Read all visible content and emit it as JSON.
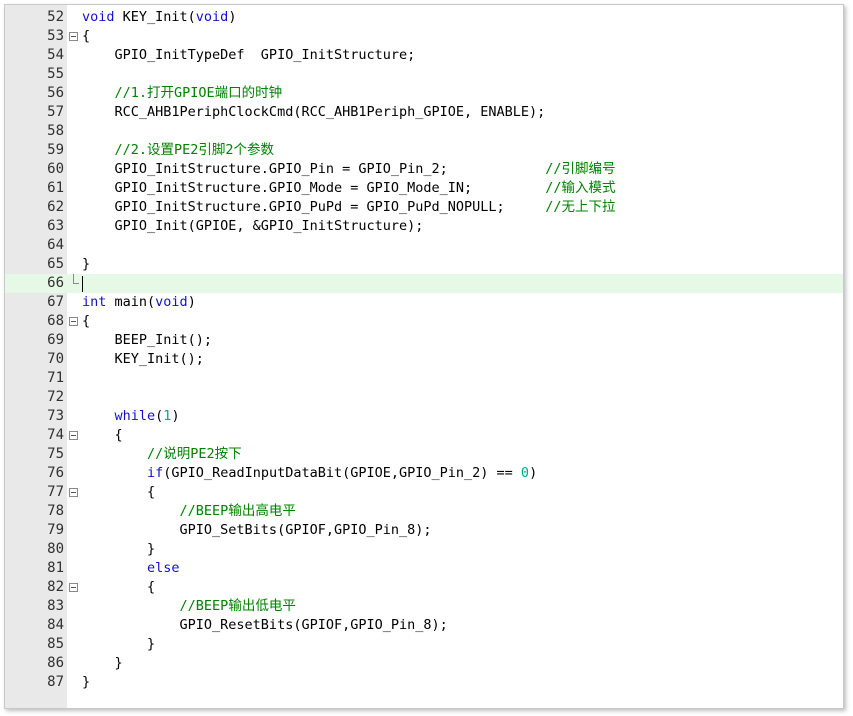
{
  "editor": {
    "colors": {
      "keyword": "#1111cc",
      "comment": "#008000",
      "number": "#00aa88",
      "text": "#000000",
      "gutter": "#e9e9e9",
      "current_line": "#e6f9e6"
    },
    "lines": [
      {
        "num": "52",
        "fold": "",
        "segments": [
          {
            "t": "kw",
            "v": "void"
          },
          {
            "t": "",
            "v": " KEY_Init("
          },
          {
            "t": "kw",
            "v": "void"
          },
          {
            "t": "",
            "v": ")"
          }
        ]
      },
      {
        "num": "53",
        "fold": "open",
        "segments": [
          {
            "t": "",
            "v": "{"
          }
        ]
      },
      {
        "num": "54",
        "fold": "",
        "segments": [
          {
            "t": "",
            "v": "    GPIO_InitTypeDef  GPIO_InitStructure;"
          }
        ]
      },
      {
        "num": "55",
        "fold": "",
        "segments": []
      },
      {
        "num": "56",
        "fold": "",
        "segments": [
          {
            "t": "",
            "v": "    "
          },
          {
            "t": "cm",
            "v": "//1.打开GPIOE端口的时钟"
          }
        ]
      },
      {
        "num": "57",
        "fold": "",
        "segments": [
          {
            "t": "",
            "v": "    RCC_AHB1PeriphClockCmd(RCC_AHB1Periph_GPIOE, ENABLE);"
          }
        ]
      },
      {
        "num": "58",
        "fold": "",
        "segments": []
      },
      {
        "num": "59",
        "fold": "",
        "segments": [
          {
            "t": "",
            "v": "    "
          },
          {
            "t": "cm",
            "v": "//2.设置PE2引脚2个参数"
          }
        ]
      },
      {
        "num": "60",
        "fold": "",
        "segments": [
          {
            "t": "",
            "v": "    GPIO_InitStructure.GPIO_Pin = GPIO_Pin_2;            "
          },
          {
            "t": "cm",
            "v": "//引脚编号"
          }
        ]
      },
      {
        "num": "61",
        "fold": "",
        "segments": [
          {
            "t": "",
            "v": "    GPIO_InitStructure.GPIO_Mode = GPIO_Mode_IN;         "
          },
          {
            "t": "cm",
            "v": "//输入模式"
          }
        ]
      },
      {
        "num": "62",
        "fold": "",
        "segments": [
          {
            "t": "",
            "v": "    GPIO_InitStructure.GPIO_PuPd = GPIO_PuPd_NOPULL;     "
          },
          {
            "t": "cm",
            "v": "//无上下拉"
          }
        ]
      },
      {
        "num": "63",
        "fold": "",
        "segments": [
          {
            "t": "",
            "v": "    GPIO_Init(GPIOE, &GPIO_InitStructure);"
          }
        ]
      },
      {
        "num": "64",
        "fold": "",
        "segments": []
      },
      {
        "num": "65",
        "fold": "",
        "segments": [
          {
            "t": "",
            "v": "}"
          }
        ]
      },
      {
        "num": "66",
        "fold": "end",
        "current": true,
        "segments": []
      },
      {
        "num": "67",
        "fold": "",
        "segments": [
          {
            "t": "kw",
            "v": "int"
          },
          {
            "t": "",
            "v": " main("
          },
          {
            "t": "kw",
            "v": "void"
          },
          {
            "t": "",
            "v": ")"
          }
        ]
      },
      {
        "num": "68",
        "fold": "open",
        "segments": [
          {
            "t": "",
            "v": "{"
          }
        ]
      },
      {
        "num": "69",
        "fold": "",
        "segments": [
          {
            "t": "",
            "v": "    BEEP_Init();"
          }
        ]
      },
      {
        "num": "70",
        "fold": "",
        "segments": [
          {
            "t": "",
            "v": "    KEY_Init();"
          }
        ]
      },
      {
        "num": "71",
        "fold": "",
        "segments": []
      },
      {
        "num": "72",
        "fold": "",
        "segments": []
      },
      {
        "num": "73",
        "fold": "",
        "segments": [
          {
            "t": "",
            "v": "    "
          },
          {
            "t": "kw",
            "v": "while"
          },
          {
            "t": "",
            "v": "("
          },
          {
            "t": "num",
            "v": "1"
          },
          {
            "t": "",
            "v": ")"
          }
        ]
      },
      {
        "num": "74",
        "fold": "open",
        "segments": [
          {
            "t": "",
            "v": "    {"
          }
        ]
      },
      {
        "num": "75",
        "fold": "",
        "segments": [
          {
            "t": "",
            "v": "        "
          },
          {
            "t": "cm",
            "v": "//说明PE2按下"
          }
        ]
      },
      {
        "num": "76",
        "fold": "",
        "segments": [
          {
            "t": "",
            "v": "        "
          },
          {
            "t": "kw",
            "v": "if"
          },
          {
            "t": "",
            "v": "(GPIO_ReadInputDataBit(GPIOE,GPIO_Pin_2) == "
          },
          {
            "t": "num",
            "v": "0"
          },
          {
            "t": "",
            "v": ")"
          }
        ]
      },
      {
        "num": "77",
        "fold": "open",
        "segments": [
          {
            "t": "",
            "v": "        {"
          }
        ]
      },
      {
        "num": "78",
        "fold": "",
        "segments": [
          {
            "t": "",
            "v": "            "
          },
          {
            "t": "cm",
            "v": "//BEEP输出高电平"
          }
        ]
      },
      {
        "num": "79",
        "fold": "",
        "segments": [
          {
            "t": "",
            "v": "            GPIO_SetBits(GPIOF,GPIO_Pin_8);"
          }
        ]
      },
      {
        "num": "80",
        "fold": "",
        "segments": [
          {
            "t": "",
            "v": "        }"
          }
        ]
      },
      {
        "num": "81",
        "fold": "",
        "segments": [
          {
            "t": "",
            "v": "        "
          },
          {
            "t": "kw",
            "v": "else"
          }
        ]
      },
      {
        "num": "82",
        "fold": "open",
        "segments": [
          {
            "t": "",
            "v": "        {"
          }
        ]
      },
      {
        "num": "83",
        "fold": "",
        "segments": [
          {
            "t": "",
            "v": "            "
          },
          {
            "t": "cm",
            "v": "//BEEP输出低电平"
          }
        ]
      },
      {
        "num": "84",
        "fold": "",
        "segments": [
          {
            "t": "",
            "v": "            GPIO_ResetBits(GPIOF,GPIO_Pin_8);"
          }
        ]
      },
      {
        "num": "85",
        "fold": "",
        "segments": [
          {
            "t": "",
            "v": "        }"
          }
        ]
      },
      {
        "num": "86",
        "fold": "",
        "segments": [
          {
            "t": "",
            "v": "    }"
          }
        ]
      },
      {
        "num": "87",
        "fold": "",
        "segments": [
          {
            "t": "",
            "v": "}"
          }
        ]
      }
    ]
  }
}
